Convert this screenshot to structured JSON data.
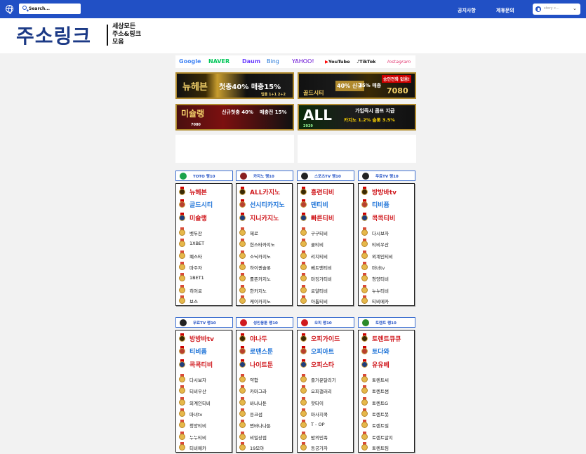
{
  "search": {
    "placeholder": "Search..."
  },
  "nav": {
    "notice": "공지사항",
    "partner": "제휴문의"
  },
  "user": {
    "name": "story c..."
  },
  "site": {
    "logo": "주소링크",
    "tagline": [
      "세상모든",
      "주소&링크",
      "모음"
    ]
  },
  "engines": [
    "Google",
    "NAVER",
    "Daum",
    "Bing",
    "YAHOO!",
    "YouTube",
    "TikTok",
    "Instagram"
  ],
  "banners": [
    {
      "name": "뉴헤븐",
      "promo": "첫충40% 매충15%",
      "side": "입플 1+1 2+2"
    },
    {
      "name": "골드시티",
      "promo": "40% 신규",
      "side": "15% 매충",
      "extra": "승인전화 없음!",
      "code": "7080"
    },
    {
      "name": "미슐랭",
      "promo": "신규첫충 40%",
      "side": "매충전 15%",
      "code": "7080"
    },
    {
      "name": "ALL",
      "promo": "가입즉시 콤프 지급",
      "side": "카지노 1.2% 슬롯 3.5%",
      "code": "2929"
    }
  ],
  "colors": {
    "brand": "#2150c5",
    "logo": "#1c3a86",
    "red": "#d0191e",
    "blue": "#1f74d8",
    "gold": "#c9a24a"
  },
  "rankings": [
    {
      "title": "TOTO 랭10",
      "icon": "toto-icon",
      "items": [
        {
          "name": "뉴헤븐",
          "color": "#d0191e",
          "big": true
        },
        {
          "name": "골드시티",
          "color": "#1f74d8",
          "big": true
        },
        {
          "name": "미슐랭",
          "color": "#d0191e",
          "big": true
        },
        {
          "name": "벳두잔",
          "big": false
        },
        {
          "name": "1XBET",
          "big": false
        },
        {
          "name": "폐스타",
          "big": false
        },
        {
          "name": "마주자",
          "big": false
        },
        {
          "name": "1BET1",
          "big": false
        },
        {
          "name": "히어로",
          "big": false
        },
        {
          "name": "보스",
          "big": false
        }
      ]
    },
    {
      "title": "카지노 랭10",
      "icon": "casino-icon",
      "items": [
        {
          "name": "ALL카지노",
          "color": "#d0191e",
          "big": true
        },
        {
          "name": "선시티카지노",
          "color": "#1f74d8",
          "big": true
        },
        {
          "name": "지니카지노",
          "color": "#d0191e",
          "big": true
        },
        {
          "name": "제로",
          "big": false
        },
        {
          "name": "헌스타카지노",
          "big": false
        },
        {
          "name": "소닉카지노",
          "big": false
        },
        {
          "name": "하이퀸슬롯",
          "big": false
        },
        {
          "name": "롤뜬카지노",
          "big": false
        },
        {
          "name": "한카지노",
          "big": false
        },
        {
          "name": "케이카지노",
          "big": false
        }
      ]
    },
    {
      "title": "스포츠TV 랭10",
      "icon": "sports-tv-icon",
      "items": [
        {
          "name": "홍련티비",
          "color": "#d0191e",
          "big": true
        },
        {
          "name": "덴티비",
          "color": "#1f74d8",
          "big": true
        },
        {
          "name": "빠른티비",
          "color": "#d0191e",
          "big": true
        },
        {
          "name": "구구티비",
          "big": false
        },
        {
          "name": "쿨티비",
          "big": false
        },
        {
          "name": "리치티비",
          "big": false
        },
        {
          "name": "베트맨티비",
          "big": false
        },
        {
          "name": "마징가티비",
          "big": false
        },
        {
          "name": "로얄티비",
          "big": false
        },
        {
          "name": "아톰티비",
          "big": false
        }
      ]
    },
    {
      "title": "무료TV 랭10",
      "icon": "free-tv-icon",
      "items": [
        {
          "name": "방방바tv",
          "color": "#d0191e",
          "big": true
        },
        {
          "name": "티비퓸",
          "color": "#1f74d8",
          "big": true
        },
        {
          "name": "콕콕티비",
          "color": "#d0191e",
          "big": true
        },
        {
          "name": "다시보자",
          "big": false
        },
        {
          "name": "티비우산",
          "big": false
        },
        {
          "name": "외계인티비",
          "big": false
        },
        {
          "name": "마녀tv",
          "big": false
        },
        {
          "name": "청양티비",
          "big": false
        },
        {
          "name": "누누티비",
          "big": false
        },
        {
          "name": "티비메카",
          "big": false
        }
      ]
    },
    {
      "title": "무료TV 랭10",
      "icon": "free-tv-icon",
      "items": [
        {
          "name": "방방바tv",
          "color": "#d0191e",
          "big": true
        },
        {
          "name": "티비퓸",
          "color": "#1f74d8",
          "big": true
        },
        {
          "name": "콕콕티비",
          "color": "#d0191e",
          "big": true
        },
        {
          "name": "다시보자",
          "big": false
        },
        {
          "name": "티비우산",
          "big": false
        },
        {
          "name": "외계인티비",
          "big": false
        },
        {
          "name": "마녀tv",
          "big": false
        },
        {
          "name": "청양티비",
          "big": false
        },
        {
          "name": "누누티비",
          "big": false
        },
        {
          "name": "티비메카",
          "big": false
        }
      ]
    },
    {
      "title": "성인웅툰 랭10",
      "icon": "adult-19-icon",
      "items": [
        {
          "name": "야나두",
          "color": "#d0191e",
          "big": true
        },
        {
          "name": "로맨스툰",
          "color": "#1f74d8",
          "big": true
        },
        {
          "name": "나이트툰",
          "color": "#d0191e",
          "big": true
        },
        {
          "name": "약함",
          "big": false
        },
        {
          "name": "카마그라",
          "big": false
        },
        {
          "name": "바나나툰",
          "big": false
        },
        {
          "name": "응크섬",
          "big": false
        },
        {
          "name": "찐바나나툰",
          "big": false
        },
        {
          "name": "비밀상점",
          "big": false
        },
        {
          "name": "19모아",
          "big": false
        }
      ]
    },
    {
      "title": "오피 랭10",
      "icon": "adult-19-icon",
      "items": [
        {
          "name": "오피가이드",
          "color": "#d0191e",
          "big": true
        },
        {
          "name": "오피아트",
          "color": "#1f74d8",
          "big": true
        },
        {
          "name": "오피스타",
          "color": "#d0191e",
          "big": true
        },
        {
          "name": "즐거운달리기",
          "big": false
        },
        {
          "name": "오피갤러리",
          "big": false
        },
        {
          "name": "핫타이",
          "big": false
        },
        {
          "name": "마사지콕",
          "big": false
        },
        {
          "name": "T - OP",
          "big": false
        },
        {
          "name": "밤의민족",
          "big": false
        },
        {
          "name": "동궁가자",
          "big": false
        }
      ]
    },
    {
      "title": "토렌트 랭10",
      "icon": "torrent-icon",
      "items": [
        {
          "name": "토렌트큐큐",
          "color": "#d0191e",
          "big": true
        },
        {
          "name": "토다와",
          "color": "#1f74d8",
          "big": true
        },
        {
          "name": "유유베",
          "color": "#d0191e",
          "big": true
        },
        {
          "name": "토렌트씨",
          "big": false
        },
        {
          "name": "토렌트썸",
          "big": false
        },
        {
          "name": "토렌트G",
          "big": false
        },
        {
          "name": "토렌트봇",
          "big": false
        },
        {
          "name": "토렌트릴",
          "big": false
        },
        {
          "name": "토렌트알지",
          "big": false
        },
        {
          "name": "토렌트팀",
          "big": false
        }
      ]
    }
  ]
}
